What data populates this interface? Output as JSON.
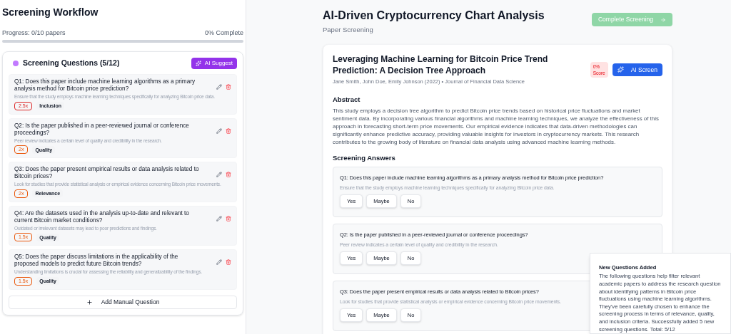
{
  "sidebar": {
    "title": "Screening Workflow",
    "progress_label": "Progress: 0/10 papers",
    "progress_percent": "0% Complete",
    "progress": {
      "level": 0
    },
    "questions_panel": {
      "title": "Screening Questions (5/12)",
      "ai_suggest": "AI Suggest",
      "questions": [
        {
          "text": "Q1: Does this paper include machine learning algorithms as a primary analysis method for Bitcoin price prediction?",
          "hint": "Ensure that the study employs machine learning techniques specifically for analyzing Bitcoin price data.",
          "weight": "2.5x",
          "color": "#dc2626",
          "category": "Inclusion"
        },
        {
          "text": "Q2: Is the paper published in a peer-reviewed journal or conference proceedings?",
          "hint": "Peer review indicates a certain level of quality and credibility in the research.",
          "weight": "2x",
          "color": "#ea580c",
          "category": "Quality"
        },
        {
          "text": "Q3: Does the paper present empirical results or data analysis related to Bitcoin prices?",
          "hint": "Look for studies that provide statistical analysis or empirical evidence concerning Bitcoin price movements.",
          "weight": "2x",
          "color": "#ea580c",
          "category": "Relevance"
        },
        {
          "text": "Q4: Are the datasets used in the analysis up-to-date and relevant to current Bitcoin market conditions?",
          "hint": "Outdated or irrelevant datasets may lead to poor predictions and findings.",
          "weight": "1.5x",
          "color": "#ea580c",
          "category": "Quality"
        },
        {
          "text": "Q5: Does the paper discuss limitations in the applicability of the proposed models to predict future Bitcoin trends?",
          "hint": "Understanding limitations is crucial for assessing the reliability and generalizability of the findings.",
          "weight": "1.5x",
          "color": "#ea580c",
          "category": "Quality"
        }
      ],
      "add_button": "Add Manual Question"
    }
  },
  "main": {
    "title": "AI-Driven Cryptocurrency Chart Analysis",
    "subtitle": "Paper Screening",
    "complete_button": {
      "label": "Complete Screening",
      "disabled": true
    },
    "paper": {
      "title": "Leveraging Machine Learning for Bitcoin Price Trend Prediction: A Decision Tree Approach",
      "meta": "Jane Smith, John Doe, Emily Johnson (2022) • Journal of Financial Data Science",
      "score": [
        "0%",
        "Score"
      ],
      "ai_screen": "AI Screen",
      "abstract_heading": "Abstract",
      "abstract": "This study employs a decision tree algorithm to predict Bitcoin price trends based on historical price fluctuations and market sentiment data. By incorporating various financial algorithms and machine learning techniques, we analyze the effectiveness of this approach in forecasting short-term price movements. Our empirical evidence indicates that data-driven methodologies can significantly enhance predictive accuracy, providing valuable insights for investors in cryptocurrency markets. This research contributes to the growing body of literature on financial data analysis using advanced machine learning methods.",
      "answers_heading": "Screening Answers",
      "answers": [
        {
          "question": "Q1: Does this paper include machine learning algorithms as a primary analysis method for Bitcoin price prediction?",
          "hint": "Ensure that the study employs machine learning techniques specifically for analyzing Bitcoin price data.",
          "options": [
            {
              "label": "Yes",
              "selected": false
            },
            {
              "label": "Maybe",
              "selected": false
            },
            {
              "label": "No",
              "selected": false
            }
          ]
        },
        {
          "question": "Q2: Is the paper published in a peer-reviewed journal or conference proceedings?",
          "hint": "Peer review indicates a certain level of quality and credibility in the research.",
          "options": [
            {
              "label": "Yes",
              "selected": false
            },
            {
              "label": "Maybe",
              "selected": false
            },
            {
              "label": "No",
              "selected": false
            }
          ]
        },
        {
          "question": "Q3: Does the paper present empirical results or data analysis related to Bitcoin prices?",
          "hint": "Look for studies that provide statistical analysis or empirical evidence concerning Bitcoin price movements.",
          "options": [
            {
              "label": "Yes",
              "selected": false
            },
            {
              "label": "Maybe",
              "selected": false
            },
            {
              "label": "No",
              "selected": false
            }
          ]
        }
      ]
    }
  },
  "toast": {
    "title": "New Questions Added",
    "message": "The following questions help filter relevant academic papers to address the research question about identifying patterns in Bitcoin price fluctuations using machine learning algorithms. They've been carefully chosen to enhance the screening process in terms of relevance, quality, and inclusion criteria. Successfully added 5 new screening questions. Total: 5/12"
  }
}
